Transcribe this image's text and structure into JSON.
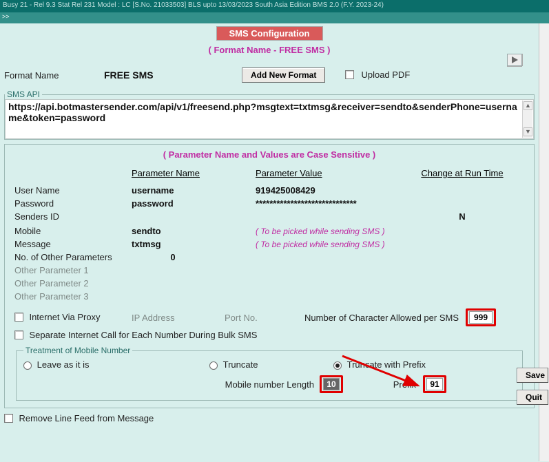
{
  "titlebar": "Busy 21 - Rel 9.3    Stat Rel 231    Model : LC [S.No. 21033503]    BLS upto 13/03/2023    South Asia Edition    BMS 2.0 (F.Y. 2023-24)",
  "toolbox_mark": ">>",
  "banner": "SMS Configuration",
  "format_sub_prefix": "( Format Name - ",
  "format_sub_value": "FREE SMS",
  "format_sub_suffix": " )",
  "labels": {
    "format_name": "Format Name",
    "add_new_format": "Add New Format",
    "upload_pdf": "Upload PDF",
    "sms_api": "SMS API",
    "case_warn": "( Parameter Name and Values are Case Sensitive )",
    "param_name": "Parameter Name",
    "param_value": "Parameter Value",
    "change_runtime": "Change at Run Time",
    "user_name": "User Name",
    "password": "Password",
    "senders_id": "Senders ID",
    "mobile": "Mobile",
    "message": "Message",
    "no_other_params": "No. of Other Parameters",
    "other_param1": "Other Parameter 1",
    "other_param2": "Other Parameter 2",
    "other_param3": "Other Parameter 3",
    "internet_via_proxy": "Internet Via Proxy",
    "ip_address": "IP Address",
    "port_no": "Port No.",
    "char_allowed": "Number of Character Allowed per SMS",
    "separate_call": "Separate Internet Call for Each Number During Bulk SMS",
    "treatment": "Treatment of Mobile Number",
    "leave": "Leave as it is",
    "truncate": "Truncate",
    "truncate_prefix": "Truncate with Prefix",
    "mobile_len": "Mobile number Length",
    "prefix": "Prefix",
    "remove_lf": "Remove Line Feed from Message",
    "save": "Save",
    "quit": "Quit",
    "picked_note": "( To be picked while sending SMS )"
  },
  "values": {
    "format_name": "FREE SMS",
    "sms_api_text": "https://api.botmastersender.com/api/v1/freesend.php?msgtext=txtmsg&receiver=sendto&senderPhone=username&token=password",
    "user_name_param": "username",
    "user_name_value": "919425008429",
    "password_param": "password",
    "password_value": "*****************************",
    "senders_runtime": "N",
    "mobile_param": "sendto",
    "message_param": "txtmsg",
    "no_other_params": "0",
    "char_allowed": "999",
    "mobile_len": "10",
    "prefix": "91"
  }
}
